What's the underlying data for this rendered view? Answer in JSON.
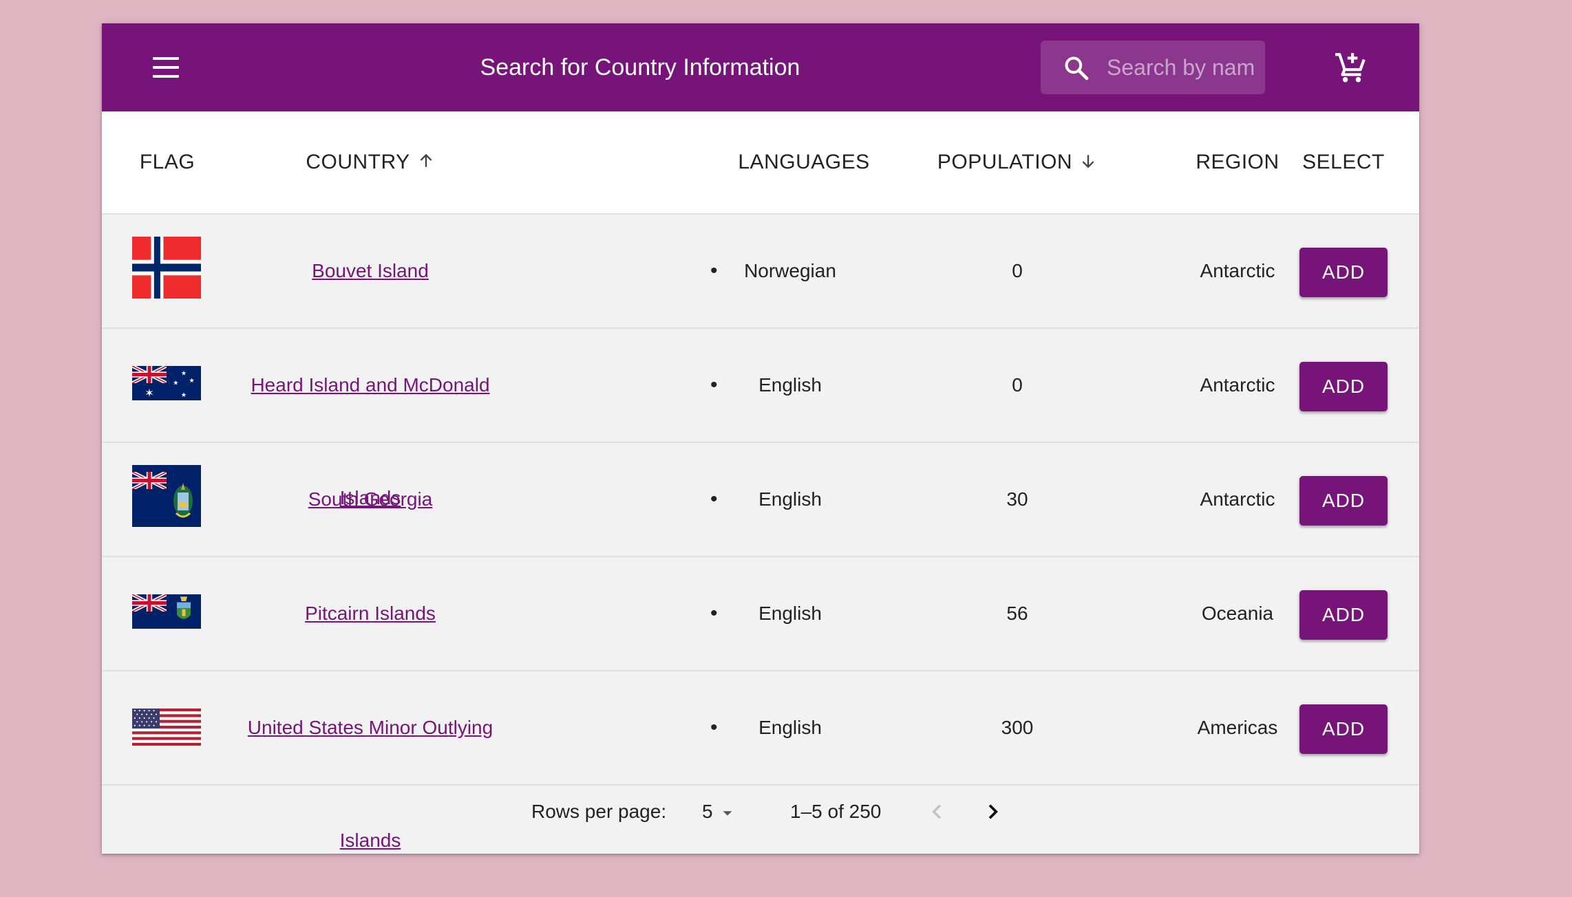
{
  "app": {
    "title": "Search for Country Information",
    "search_placeholder": "Search by name"
  },
  "colors": {
    "brand": "#761479",
    "page_background": "#dfb5c2",
    "table_background": "#f2f2f2"
  },
  "icons": {
    "menu": "menu-icon",
    "search": "search-icon",
    "cart": "add-shopping-cart-icon",
    "sort_asc": "arrow-up-icon",
    "sort_desc": "arrow-down-icon",
    "dropdown": "arrow-drop-down-icon",
    "prev": "chevron-left-icon",
    "next": "chevron-right-icon"
  },
  "table": {
    "headers": {
      "flag": "FLAG",
      "country": "COUNTRY",
      "languages": "LANGUAGES",
      "population": "POPULATION",
      "region": "REGION",
      "select": "SELECT"
    },
    "rows": [
      {
        "flag": "norway-flag",
        "country": "Bouvet Island",
        "languages": [
          "Norwegian"
        ],
        "population": "0",
        "region": "Antarctic",
        "action": "ADD"
      },
      {
        "flag": "australia-flag",
        "country": "Heard Island and McDonald Islands",
        "languages": [
          "English"
        ],
        "population": "0",
        "region": "Antarctic",
        "action": "ADD"
      },
      {
        "flag": "south-georgia-flag",
        "country": "South Georgia",
        "languages": [
          "English"
        ],
        "population": "30",
        "region": "Antarctic",
        "action": "ADD"
      },
      {
        "flag": "pitcairn-flag",
        "country": "Pitcairn Islands",
        "languages": [
          "English"
        ],
        "population": "56",
        "region": "Oceania",
        "action": "ADD"
      },
      {
        "flag": "united-states-flag",
        "country": "United States Minor Outlying Islands",
        "languages": [
          "English"
        ],
        "population": "300",
        "region": "Americas",
        "action": "ADD"
      }
    ]
  },
  "pagination": {
    "rows_per_page_label": "Rows per page:",
    "rows_per_page": "5",
    "range": "1–5 of 250"
  }
}
